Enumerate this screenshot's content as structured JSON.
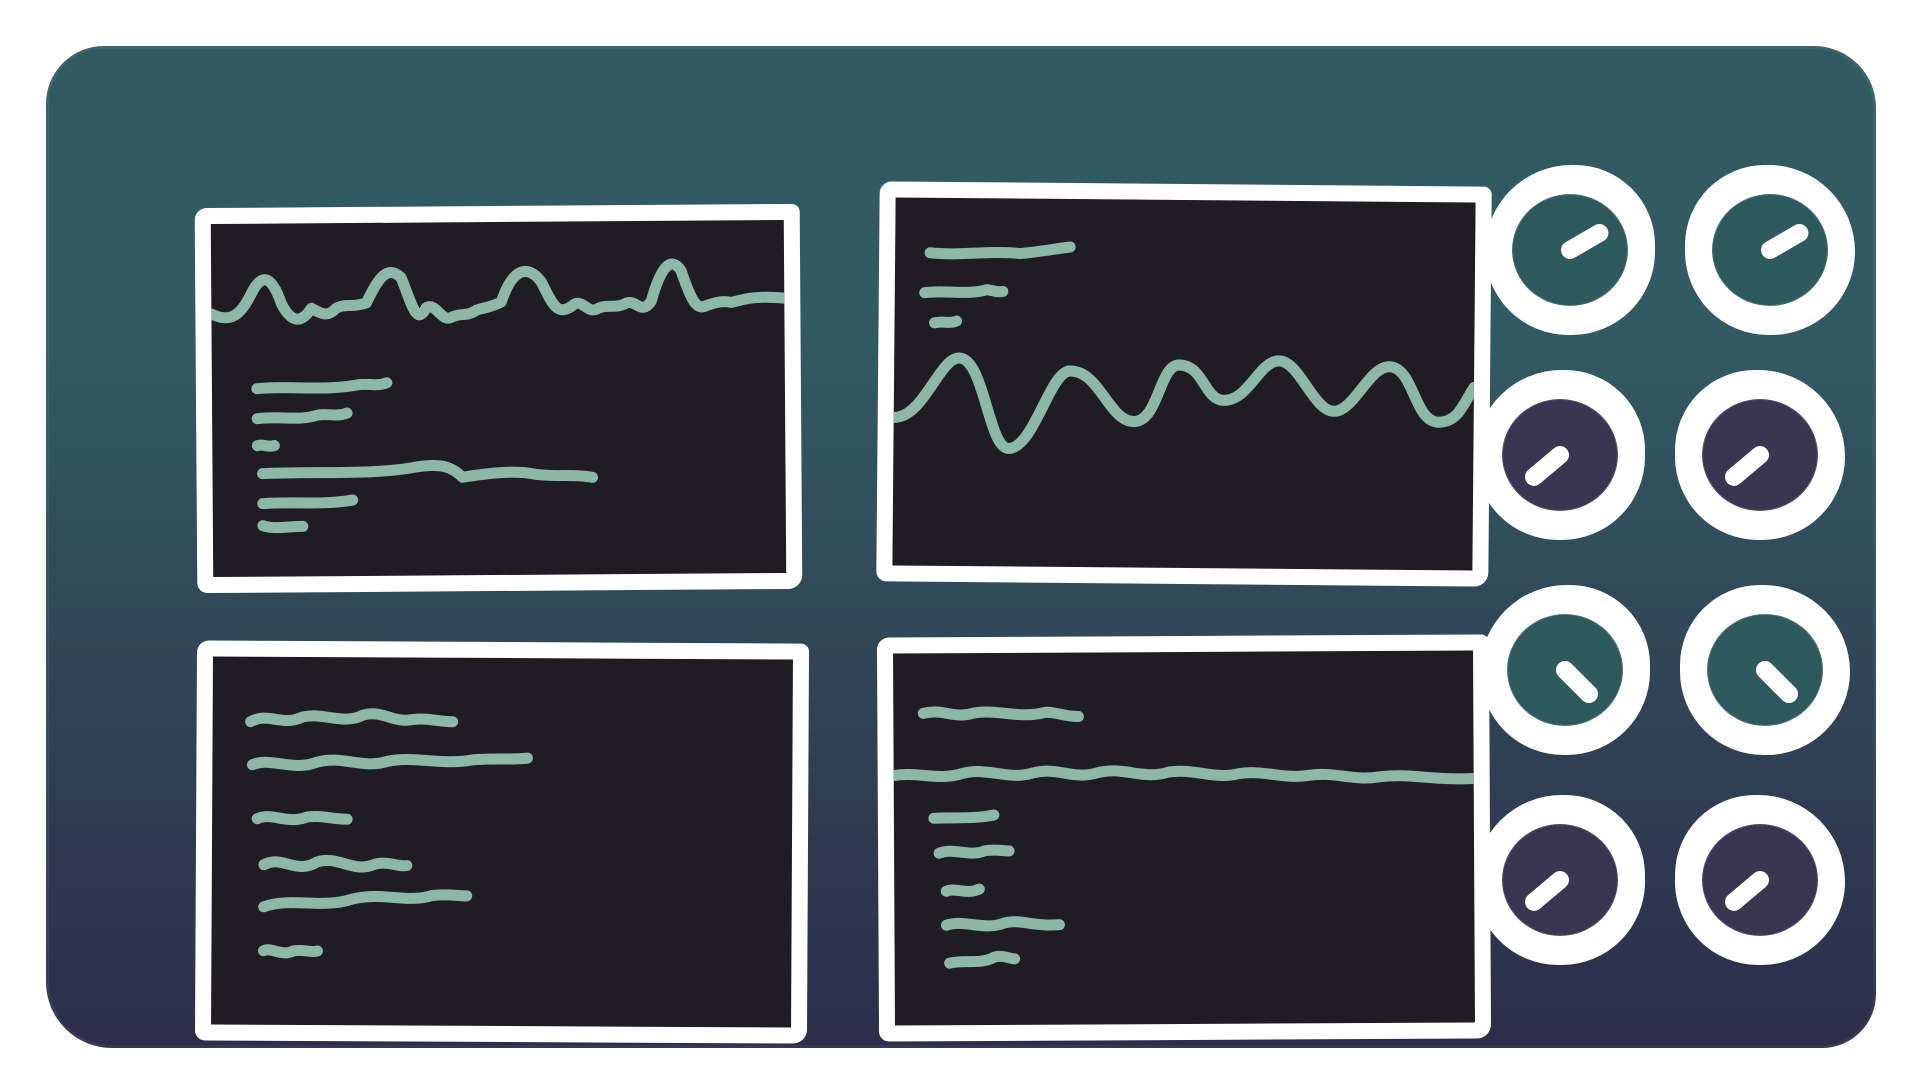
{
  "colors": {
    "page_background": "#ffffff",
    "console_top": "#325a62",
    "console_bottom": "#2e2d4b",
    "screen_background": "#1f1d23",
    "frame": "#ffffff",
    "trace": "#8db8a8",
    "knob_teal": "#2e5a5e",
    "knob_purple": "#3a3550"
  },
  "screens": [
    {
      "name": "monitor-top-left",
      "content": [
        "squiggly-waveform",
        "text-lines"
      ]
    },
    {
      "name": "monitor-top-right",
      "content": [
        "text-lines",
        "sine-waveform"
      ]
    },
    {
      "name": "monitor-bottom-left",
      "content": [
        "text-lines"
      ]
    },
    {
      "name": "monitor-bottom-right",
      "content": [
        "text-lines",
        "flat-waveform"
      ]
    }
  ],
  "knobs": [
    {
      "name": "knob-1",
      "color": "teal",
      "icon": "dial-icon"
    },
    {
      "name": "knob-2",
      "color": "teal",
      "icon": "dial-icon"
    },
    {
      "name": "knob-3",
      "color": "purple",
      "icon": "dial-icon"
    },
    {
      "name": "knob-4",
      "color": "purple",
      "icon": "dial-icon"
    },
    {
      "name": "knob-5",
      "color": "teal",
      "icon": "dial-icon"
    },
    {
      "name": "knob-6",
      "color": "teal",
      "icon": "dial-icon"
    },
    {
      "name": "knob-7",
      "color": "purple",
      "icon": "dial-icon"
    },
    {
      "name": "knob-8",
      "color": "purple",
      "icon": "dial-icon"
    }
  ]
}
